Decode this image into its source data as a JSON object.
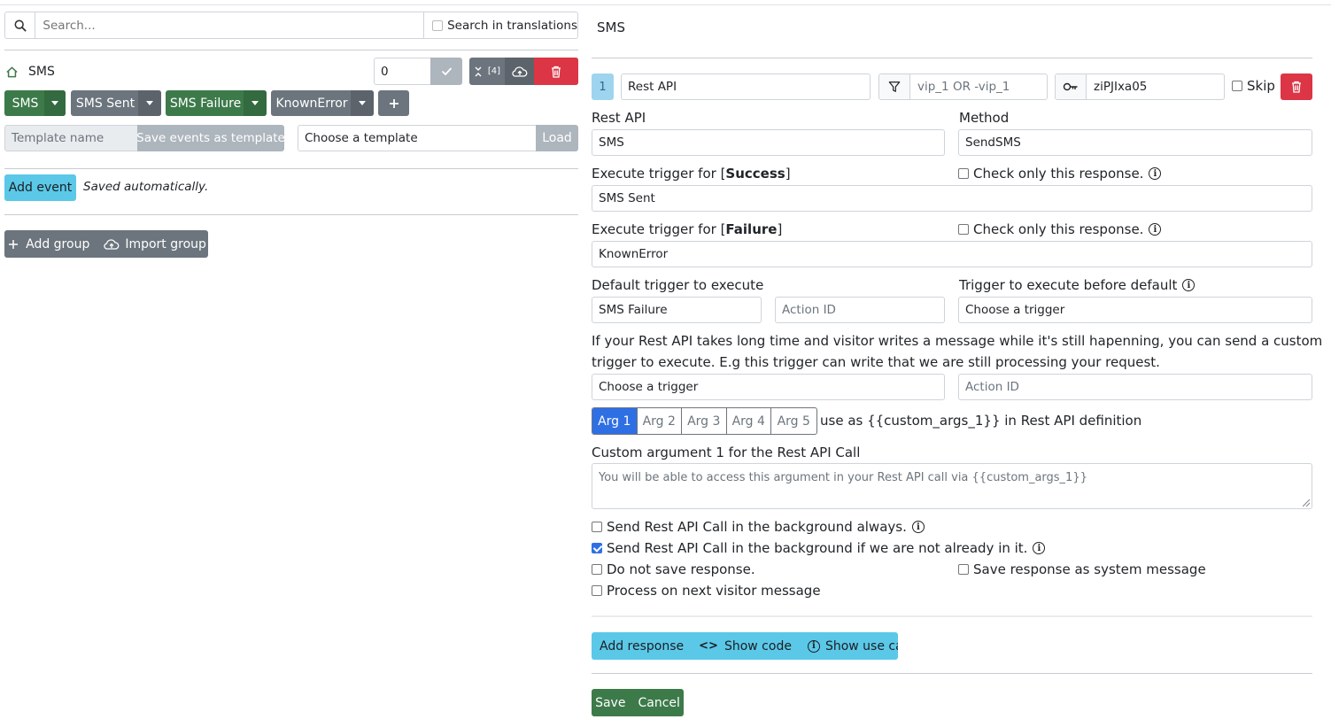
{
  "left": {
    "search_placeholder": "Search...",
    "search_translations_label": "Search in translations",
    "group_name": "SMS",
    "group_counter_value": "0",
    "collapse_count": "[4]",
    "events": [
      {
        "label": "SMS",
        "color": "green"
      },
      {
        "label": "SMS Sent",
        "color": "gray"
      },
      {
        "label": "SMS Failure",
        "color": "green"
      },
      {
        "label": "KnownError",
        "color": "gray"
      }
    ],
    "template_name_placeholder": "Template name",
    "save_template_label": "Save events as template",
    "choose_template_label": "Choose a template",
    "load_label": "Load",
    "add_event_label": "Add event",
    "saved_note": "Saved automatically.",
    "add_group_label": "Add group",
    "import_group_label": "Import group"
  },
  "right": {
    "title": "SMS",
    "step_number": "1",
    "step_type": "Rest API",
    "filter_placeholder": "vip_1 OR -vip_1",
    "key_value": "ziPJIxa05",
    "skip_label": "Skip",
    "rest_api_label": "Rest API",
    "rest_api_value": "SMS",
    "method_label": "Method",
    "method_value": "SendSMS",
    "success_prefix": "Execute trigger for [",
    "success_word": "Success",
    "success_suffix": "]",
    "failure_prefix": "Execute trigger for [",
    "failure_word": "Failure",
    "failure_suffix": "]",
    "check_only_label": "Check only this response.",
    "success_trigger": "SMS Sent",
    "failure_trigger": "KnownError",
    "default_trigger_label": "Default trigger to execute",
    "default_trigger_value": "SMS Failure",
    "action_id_placeholder": "Action ID",
    "before_default_label": "Trigger to execute before default",
    "choose_trigger_label": "Choose a trigger",
    "long_time_text_1": "If your Rest API takes long time and visitor writes a message while it's still hapenning, you can send a custom",
    "long_time_text_2": "trigger to execute. E.g this trigger can write that we are still processing your request.",
    "args": [
      "Arg 1",
      "Arg 2",
      "Arg 3",
      "Arg 4",
      "Arg 5"
    ],
    "args_hint": "use as {{custom_args_1}} in Rest API definition",
    "custom_arg_label": "Custom argument 1 for the Rest API Call",
    "custom_arg_placeholder": "You will be able to access this argument in your Rest API call via {{custom_args_1}}",
    "bg_always_label": "Send Rest API Call in the background always.",
    "bg_not_already_label": "Send Rest API Call in the background if we are not already in it.",
    "do_not_save_label": "Do not save response.",
    "save_system_label": "Save response as system message",
    "process_next_label": "Process on next visitor message",
    "add_response_label": "Add response",
    "show_code_label": "Show code",
    "show_use_cases_label": "Show use cases",
    "save_label": "Save",
    "cancel_label": "Cancel"
  }
}
